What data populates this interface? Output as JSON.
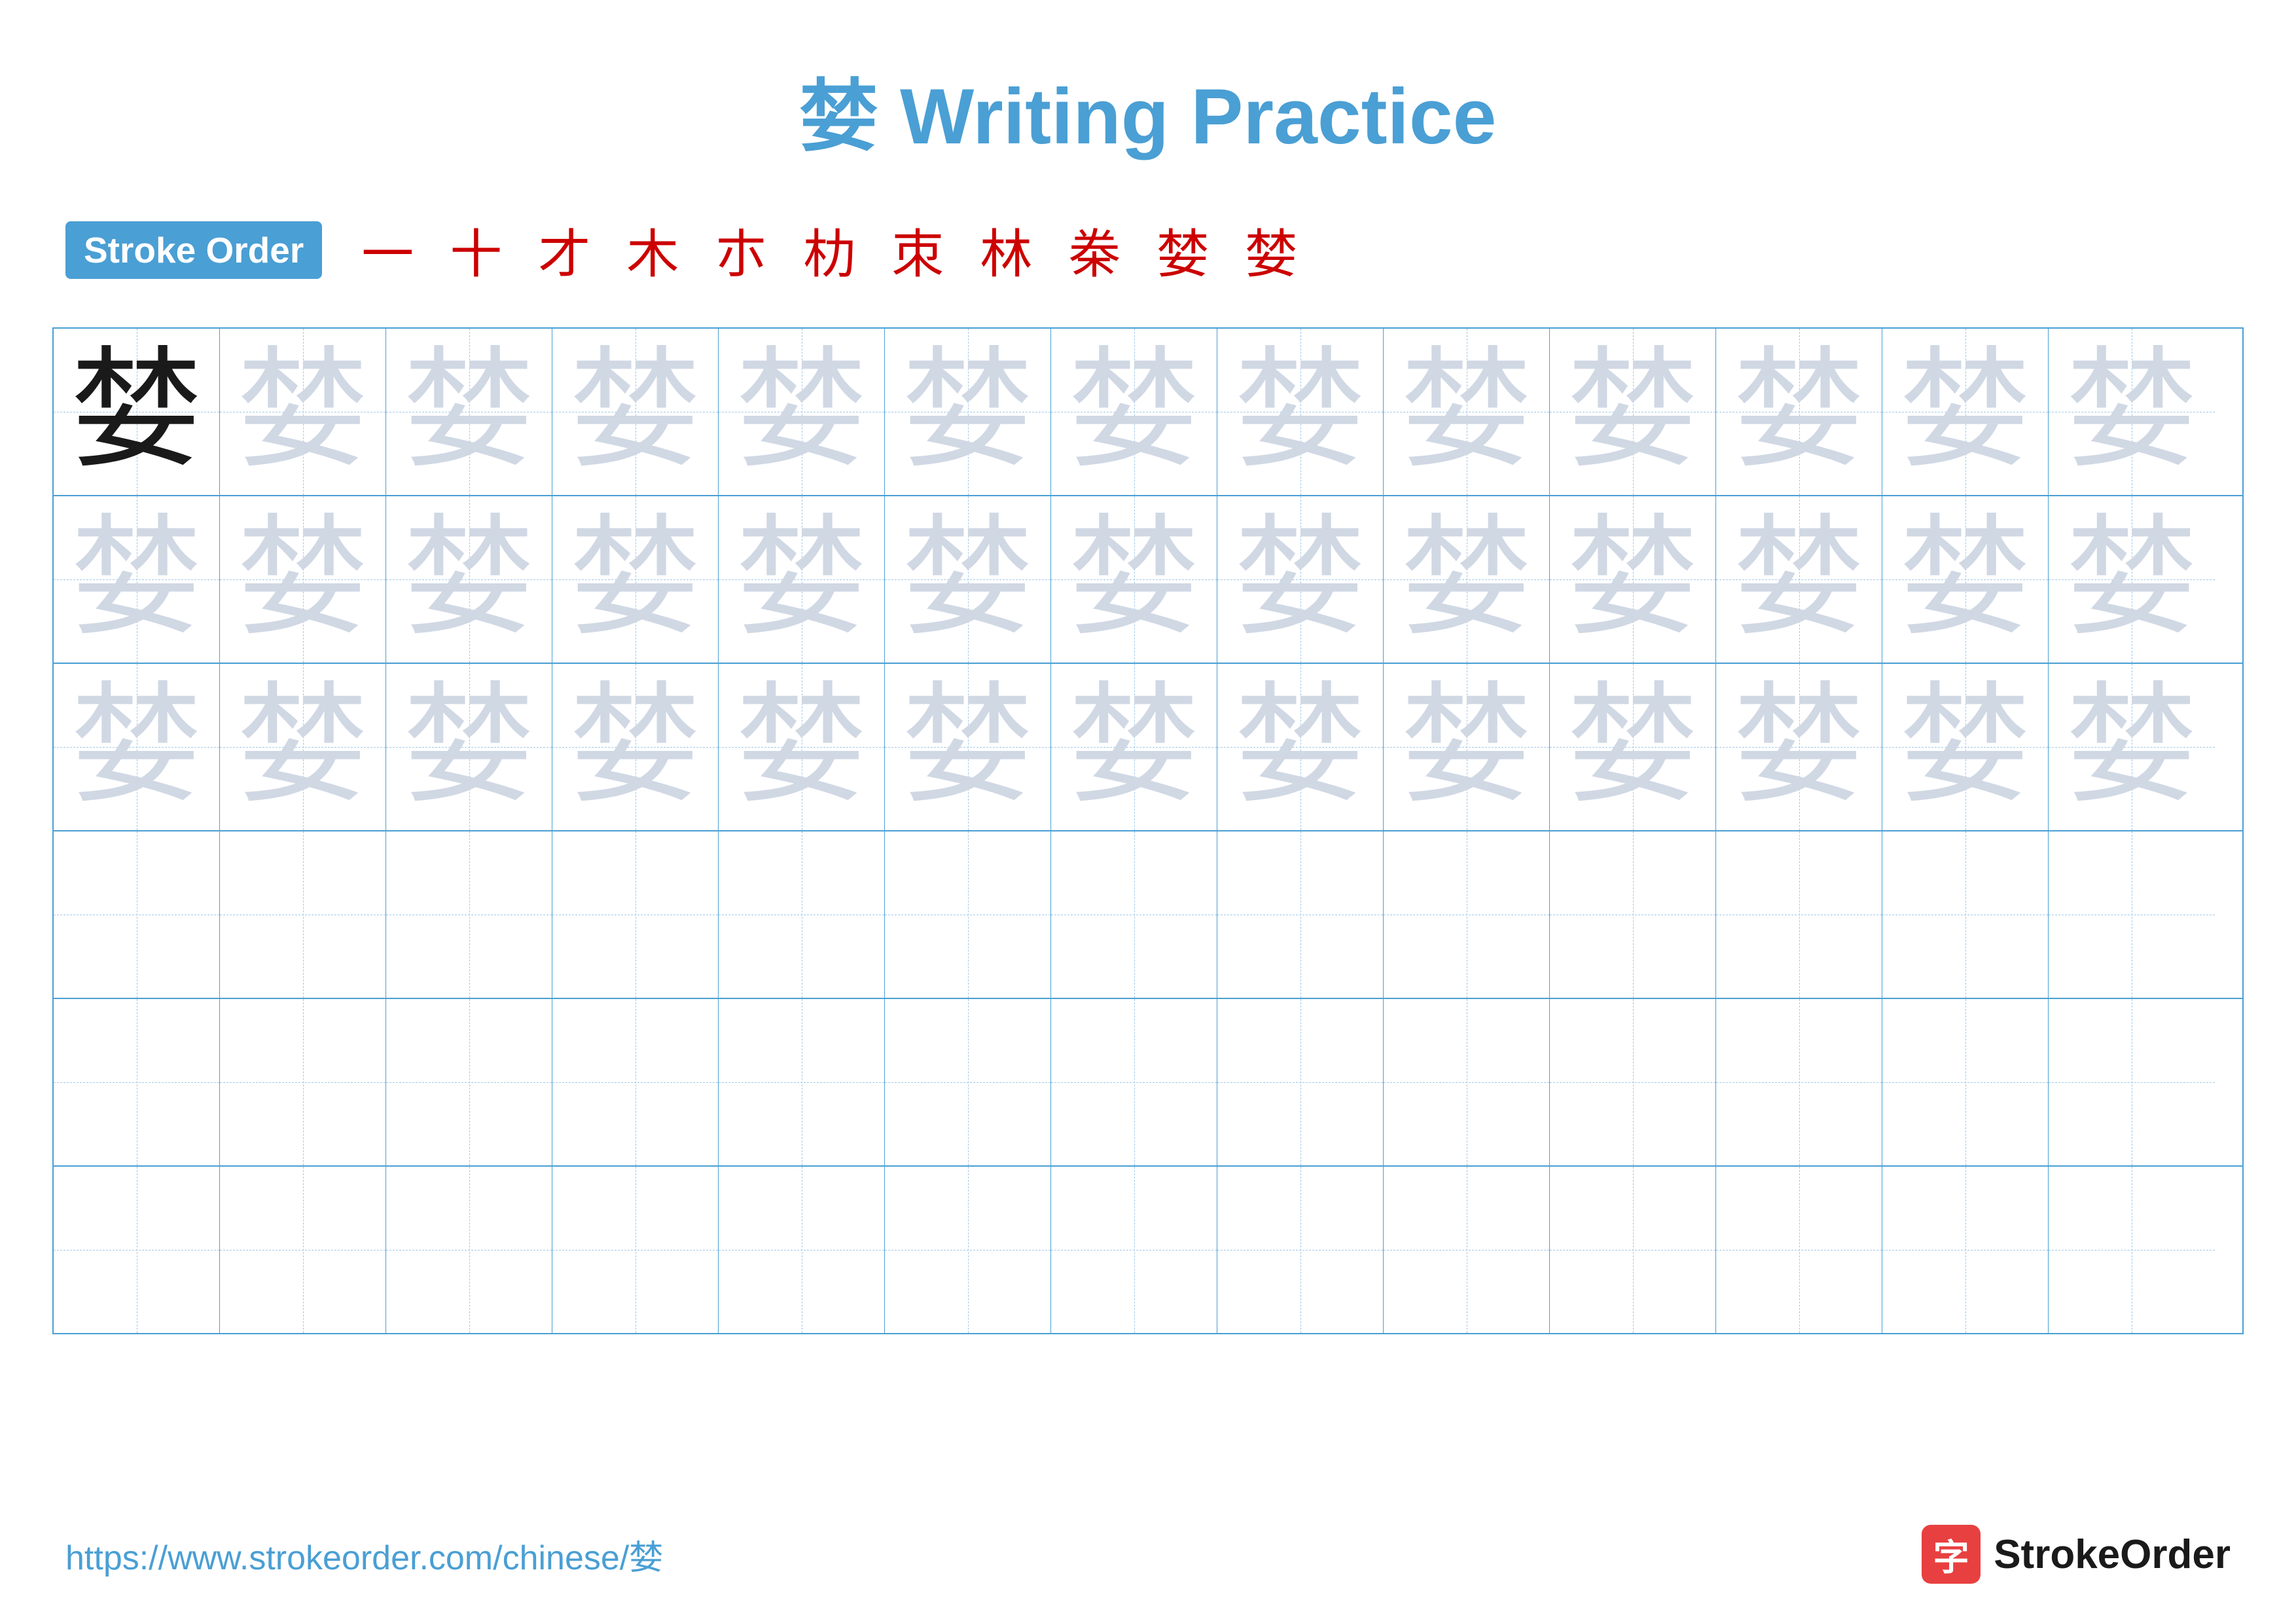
{
  "title": {
    "char": "婪",
    "label": "Writing Practice",
    "full": "婪 Writing Practice"
  },
  "stroke_order": {
    "badge_label": "Stroke Order",
    "strokes": [
      "一",
      "十",
      "才",
      "木",
      "朩",
      "朸",
      "朿",
      "林",
      "桊",
      "婪",
      "婪"
    ]
  },
  "grid": {
    "rows": 6,
    "cols": 13,
    "practice_char": "婪",
    "filled_rows": 3
  },
  "footer": {
    "url": "https://www.strokeorder.com/chinese/婪",
    "logo_char": "字",
    "logo_label": "StrokeOrder"
  }
}
